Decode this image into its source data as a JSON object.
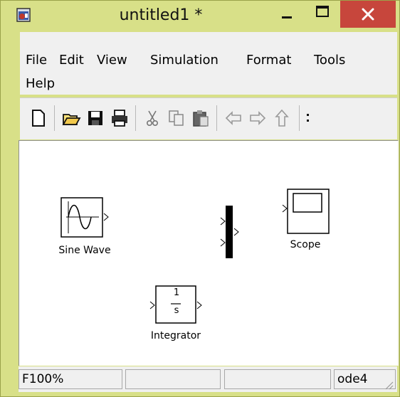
{
  "window": {
    "title": "untitled1 *"
  },
  "menubar": {
    "items": [
      "File",
      "Edit",
      "View",
      "Simulation",
      "Format",
      "Tools",
      "Help"
    ]
  },
  "toolbar": {
    "buttons": [
      "new-icon",
      "open-folder-icon",
      "save-icon",
      "print-icon",
      "cut-icon",
      "copy-icon",
      "paste-icon",
      "back-arrow-icon",
      "forward-arrow-icon",
      "up-arrow-icon"
    ]
  },
  "blocks": {
    "sine_wave": {
      "label": "Sine Wave"
    },
    "mux": {
      "label": ""
    },
    "scope": {
      "label": "Scope"
    },
    "integrator": {
      "label": "Integrator",
      "numerator": "1",
      "denominator": "s"
    }
  },
  "statusbar": {
    "zoom": "100%",
    "solver": "ode4",
    "left_fragment": "F"
  },
  "colors": {
    "title_bar": "#d8e088",
    "close_button": "#c7463c"
  }
}
